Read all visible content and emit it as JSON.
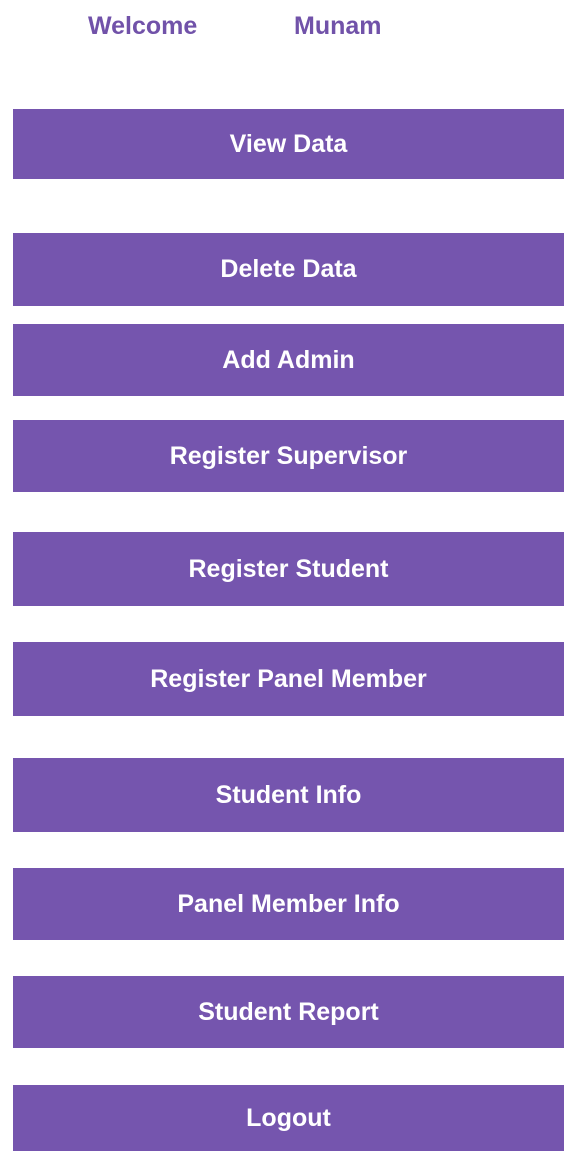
{
  "header": {
    "welcome_label": "Welcome",
    "user_name": "Munam"
  },
  "menu": {
    "buttons": [
      {
        "label": "View Data"
      },
      {
        "label": "Delete Data"
      },
      {
        "label": "Add Admin"
      },
      {
        "label": "Register Supervisor"
      },
      {
        "label": "Register Student"
      },
      {
        "label": "Register Panel Member"
      },
      {
        "label": "Student Info"
      },
      {
        "label": "Panel Member Info"
      },
      {
        "label": "Student Report"
      },
      {
        "label": "Logout"
      }
    ]
  },
  "colors": {
    "accent": "#7555ae",
    "header_text": "#7152a9",
    "button_text": "#ffffff"
  }
}
